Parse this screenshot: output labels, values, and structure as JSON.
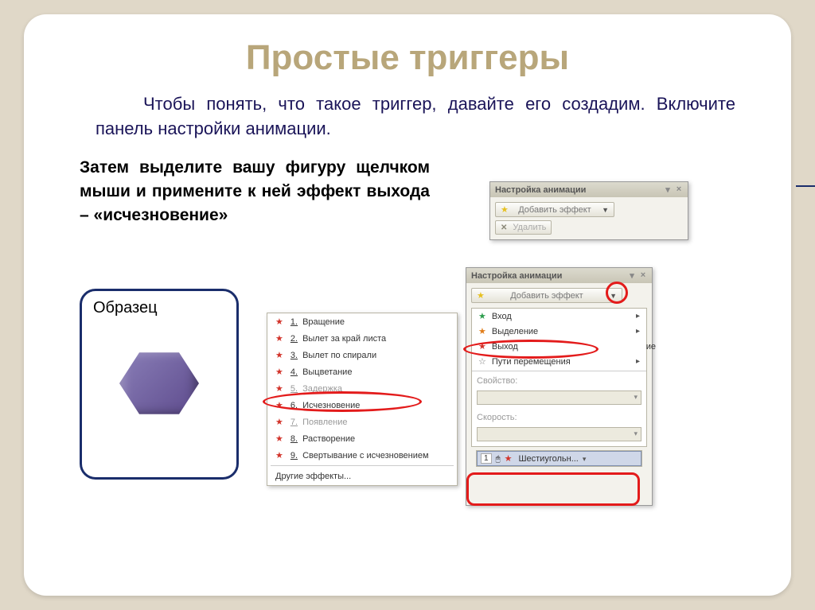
{
  "title": "Простые триггеры",
  "para1": "Чтобы понять, что такое триггер, давайте его создадим.  Включите панель настройки анимации.",
  "para2": "Затем выделите  вашу фигуру щелчком мыши и примените к ней эффект выхода – «исчезновение»",
  "sample_label": "Образец",
  "panel": {
    "title": "Настройка анимации",
    "add_effect": "Добавить эффект",
    "delete": "Удалить",
    "property": "Свойство:",
    "speed": "Скорость:"
  },
  "menu_categories": {
    "entry": "Вход",
    "emphasis": "Выделение",
    "exit": "Выход",
    "motion": "Пути перемещения"
  },
  "hidden_suffix": "ие",
  "effects": {
    "e1": "Вращение",
    "e2": "Вылет за край листа",
    "e3": "Вылет по спирали",
    "e4": "Выцветание",
    "e5": "Задержка",
    "e6": "Исчезновение",
    "e7": "Появление",
    "e8": "Растворение",
    "e9": "Свертывание с исчезновением",
    "more": "Другие эффекты..."
  },
  "nums": {
    "n1": "1.",
    "n2": "2.",
    "n3": "3.",
    "n4": "4.",
    "n5": "5.",
    "n6": "6.",
    "n7": "7.",
    "n8": "8.",
    "n9": "9."
  },
  "anim_item": {
    "index": "1",
    "name": "Шестиугольн..."
  },
  "window": {
    "dropdown": "▾",
    "close": "×"
  }
}
